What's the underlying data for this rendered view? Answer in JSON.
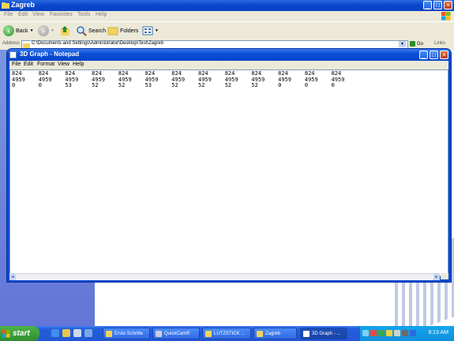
{
  "explorer": {
    "title": "Zagreb",
    "menu": [
      "File",
      "Edit",
      "View",
      "Favorites",
      "Tools",
      "Help"
    ],
    "toolbar": {
      "back": "Back",
      "search": "Search",
      "folders": "Folders"
    },
    "address_label": "Address",
    "address_value": "C:\\Documents and Settings\\Administrator\\Desktop\\Test\\Zagreb",
    "go": "Go",
    "links": "Links"
  },
  "notepad": {
    "title": "3D Graph - Notepad",
    "menu": [
      "File",
      "Edit",
      "Format",
      "View",
      "Help"
    ],
    "content": "824     824     824     824     824     824     824     824     824     824     824     824     824\n4959    4959    4959    4959    4959    4959    4959    4959    4959    4959    4959    4959    4959\n0       0       53      52      52      53      52      52      52      52      0       0       0"
  },
  "taskbar": {
    "start": "start",
    "tasks": [
      "Erste Schritte",
      "QuickCam®",
      "LUTZSTICK ...",
      "Zagreb",
      "3D Graph - ..."
    ],
    "clock": "9:13 AM"
  },
  "colors": {
    "xp_blue": "#0a48d0",
    "start_green": "#3a9d37",
    "tray_blue": "#0f8fdc"
  }
}
